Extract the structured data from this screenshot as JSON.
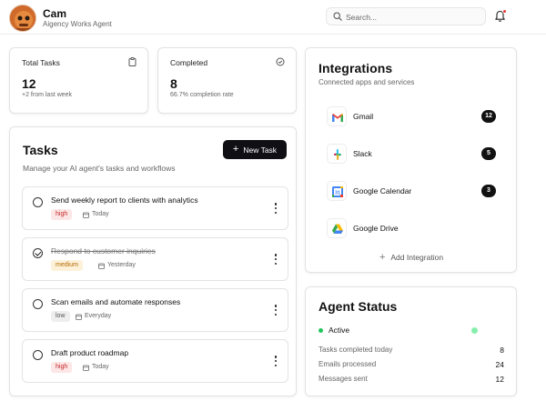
{
  "user": {
    "name": "Cam",
    "role": "Aigency Works Agent"
  },
  "search": {
    "placeholder": "Search..."
  },
  "stats": {
    "total": {
      "label": "Total Tasks",
      "value": "12",
      "sub": "+2 from last week"
    },
    "completed": {
      "label": "Completed",
      "value": "8",
      "sub": "66.7% completion rate"
    }
  },
  "tasks": {
    "title": "Tasks",
    "subtitle": "Manage your AI agent's tasks and workflows",
    "new_button": "New Task",
    "items": [
      {
        "title": "Send weekly report to clients with analytics",
        "priority": "high",
        "date": "Today",
        "done": false
      },
      {
        "title": "Respond to customer inquiries",
        "priority": "medium",
        "date": "Yesterday",
        "done": true
      },
      {
        "title": "Scan emails and automate responses",
        "priority": "low",
        "date": "Everyday",
        "done": false
      },
      {
        "title": "Draft product roadmap",
        "priority": "high",
        "date": "Today",
        "done": false
      }
    ]
  },
  "integrations": {
    "title": "Integrations",
    "subtitle": "Connected apps and services",
    "items": [
      {
        "name": "Gmail",
        "count": "12",
        "icon": "gmail-icon"
      },
      {
        "name": "Slack",
        "count": "5",
        "icon": "slack-icon"
      },
      {
        "name": "Google Calendar",
        "count": "3",
        "icon": "google-calendar-icon"
      },
      {
        "name": "Google Drive",
        "count": "",
        "icon": "google-drive-icon"
      }
    ],
    "add_label": "Add Integration"
  },
  "agent": {
    "title": "Agent Status",
    "status": "Active",
    "metrics": [
      {
        "label": "Tasks completed today",
        "value": "8"
      },
      {
        "label": "Emails processed",
        "value": "24"
      },
      {
        "label": "Messages sent",
        "value": "12"
      }
    ]
  },
  "colors": {
    "accent": "#0f0f14",
    "high": "#c62828",
    "medium": "#b26a00",
    "active": "#22c55e",
    "notification": "#e53935"
  }
}
